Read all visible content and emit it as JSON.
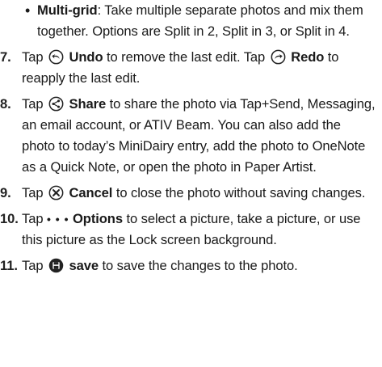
{
  "bullet": {
    "title": "Multi-grid",
    "text": ": Take multiple separate photos and mix them together. Options are Split in 2, Split in 3, or Split in 4."
  },
  "items": [
    {
      "num": "7.",
      "pre": "Tap",
      "icon": "undo-icon",
      "label": "Undo",
      "mid": "to remove the last edit. Tap",
      "icon2": "redo-icon",
      "label2": "Redo",
      "post": "to reapply the last edit."
    },
    {
      "num": "8.",
      "pre": "Tap",
      "icon": "share-icon",
      "label": "Share",
      "post": "to share the photo via Tap+Send, Messaging, an email account, or ATIV Beam. You can also add the photo to today’s MiniDairy entry, add the photo to OneNote as a Quick Note, or open the photo in Paper Artist."
    },
    {
      "num": "9.",
      "pre": "Tap",
      "icon": "cancel-icon",
      "label": "Cancel",
      "post": "to close the photo without saving changes."
    },
    {
      "num": "10.",
      "pre": "Tap",
      "icon": "options-icon",
      "icon_text": "• • •",
      "label": "Options",
      "post": "to select a picture, take a picture, or use this picture as the Lock screen background."
    },
    {
      "num": "11.",
      "pre": "Tap",
      "icon": "save-icon",
      "label": "save",
      "post": "to save the changes to the photo."
    }
  ]
}
